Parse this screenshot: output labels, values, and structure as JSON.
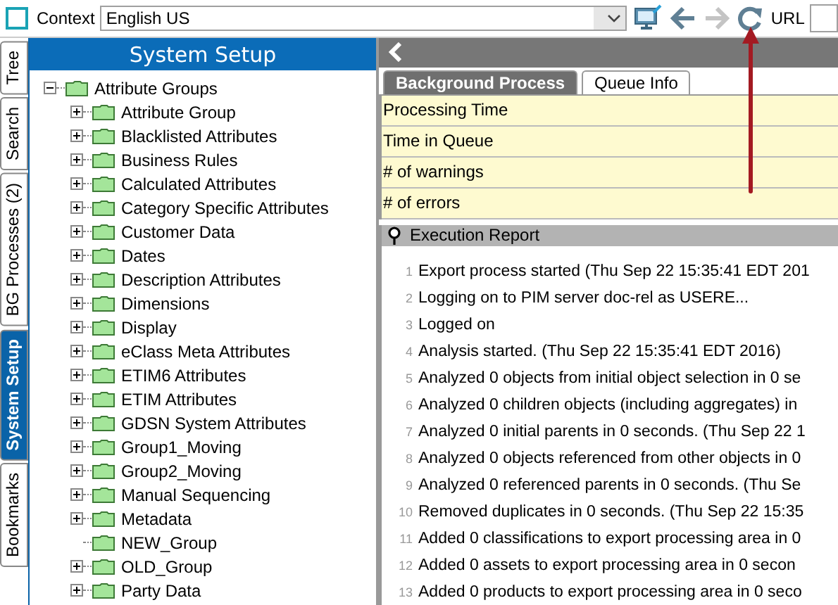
{
  "toolbar": {
    "context_label": "Context",
    "context_value": "English US",
    "forward_disabled": true,
    "url_label": "URL"
  },
  "side_tabs": [
    {
      "label": "Tree",
      "selected": false
    },
    {
      "label": "Search",
      "selected": false
    },
    {
      "label": "BG Processes (2)",
      "selected": false
    },
    {
      "label": "System Setup",
      "selected": true
    },
    {
      "label": "Bookmarks",
      "selected": false
    }
  ],
  "left_panel": {
    "title": "System Setup",
    "tree": [
      {
        "label": "Attribute Groups",
        "expanded": true,
        "children": [
          {
            "label": "Attribute Group",
            "expandable": true
          },
          {
            "label": "Blacklisted Attributes",
            "expandable": true
          },
          {
            "label": "Business Rules",
            "expandable": true
          },
          {
            "label": "Calculated Attributes",
            "expandable": true
          },
          {
            "label": "Category Specific Attributes",
            "expandable": true
          },
          {
            "label": "Customer Data",
            "expandable": true
          },
          {
            "label": "Dates",
            "expandable": true
          },
          {
            "label": "Description Attributes",
            "expandable": true
          },
          {
            "label": "Dimensions",
            "expandable": true
          },
          {
            "label": "Display",
            "expandable": true
          },
          {
            "label": "eClass Meta Attributes",
            "expandable": true
          },
          {
            "label": "ETIM6 Attributes",
            "expandable": true
          },
          {
            "label": "ETIM Attributes",
            "expandable": true
          },
          {
            "label": "GDSN System Attributes",
            "expandable": true
          },
          {
            "label": "Group1_Moving",
            "expandable": true
          },
          {
            "label": "Group2_Moving",
            "expandable": true
          },
          {
            "label": "Manual Sequencing",
            "expandable": true
          },
          {
            "label": "Metadata",
            "expandable": true
          },
          {
            "label": "NEW_Group",
            "expandable": false
          },
          {
            "label": "OLD_Group",
            "expandable": true
          },
          {
            "label": "Party Data",
            "expandable": true
          }
        ]
      }
    ]
  },
  "right_panel": {
    "tabs": [
      {
        "label": "Background Process",
        "selected": true
      },
      {
        "label": "Queue Info",
        "selected": false
      }
    ],
    "info_rows": [
      "Processing Time",
      "Time in Queue",
      "# of warnings",
      "# of errors"
    ],
    "report_title": "Execution Report",
    "report_lines": [
      {
        "number": "1",
        "text": "Export process started (Thu Sep 22 15:35:41 EDT 201"
      },
      {
        "number": "2",
        "text": "Logging on to PIM server doc-rel as USERE..."
      },
      {
        "number": "3",
        "text": "Logged on"
      },
      {
        "number": "4",
        "text": "Analysis started. (Thu Sep 22 15:35:41 EDT 2016)"
      },
      {
        "number": "5",
        "text": "Analyzed 0 objects from initial object selection in 0 se"
      },
      {
        "number": "6",
        "text": "Analyzed 0 children objects (including aggregates) in"
      },
      {
        "number": "7",
        "text": "Analyzed 0 initial parents in 0 seconds. (Thu Sep 22 1"
      },
      {
        "number": "8",
        "text": "Analyzed 0 objects referenced from other objects in 0"
      },
      {
        "number": "9",
        "text": "Analyzed 0 referenced parents in 0 seconds. (Thu Se"
      },
      {
        "number": "10",
        "text": "Removed duplicates in 0 seconds. (Thu Sep 22 15:35"
      },
      {
        "number": "11",
        "text": "Added 0 classifications to export processing area in 0"
      },
      {
        "number": "12",
        "text": "Added 0 assets to export processing area in 0 secon"
      },
      {
        "number": "13",
        "text": "Added 0 products to export processing area in 0 seco"
      }
    ]
  }
}
